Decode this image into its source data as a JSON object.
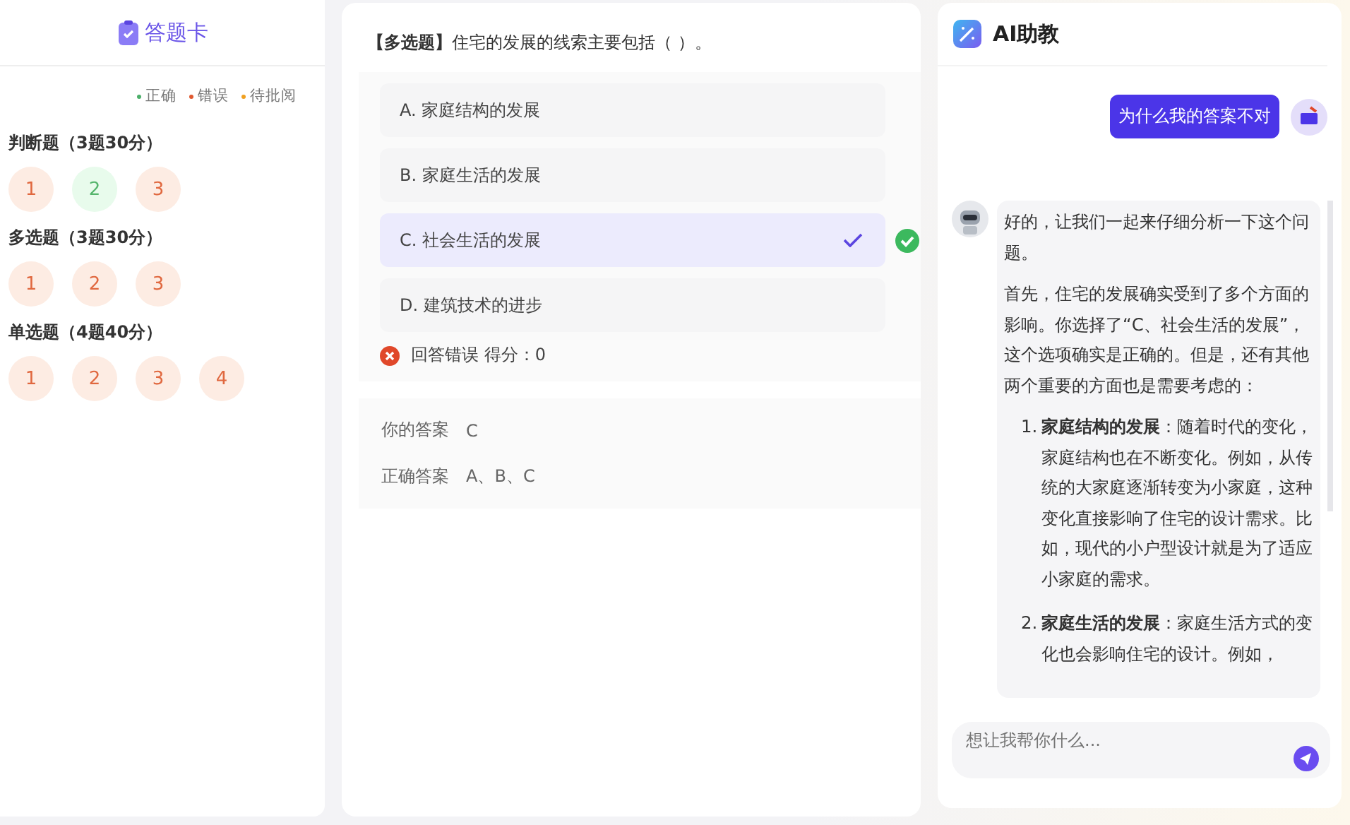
{
  "answer_card": {
    "title": "答题卡",
    "legend": [
      {
        "label": "正确",
        "color": "#4caf6a"
      },
      {
        "label": "错误",
        "color": "#e0582f"
      },
      {
        "label": "待批阅",
        "color": "#f0a020"
      }
    ],
    "sections": [
      {
        "title": "判断题（3题30分）",
        "items": [
          {
            "number": "1",
            "correct": false
          },
          {
            "number": "2",
            "correct": true
          },
          {
            "number": "3",
            "correct": false
          }
        ]
      },
      {
        "title": "多选题（3题30分）",
        "items": [
          {
            "number": "1",
            "correct": false
          },
          {
            "number": "2",
            "correct": false
          },
          {
            "number": "3",
            "correct": false
          }
        ]
      },
      {
        "title": "单选题（4题40分）",
        "items": [
          {
            "number": "1",
            "correct": false
          },
          {
            "number": "2",
            "correct": false
          },
          {
            "number": "3",
            "correct": false
          },
          {
            "number": "4",
            "correct": false
          }
        ]
      }
    ]
  },
  "question": {
    "type_label": "【多选题】",
    "text": "住宅的发展的线索主要包括（ ）。",
    "options": [
      {
        "label": "A. 家庭结构的发展",
        "selected": false,
        "marked_correct": false
      },
      {
        "label": "B. 家庭生活的发展",
        "selected": false,
        "marked_correct": false
      },
      {
        "label": "C. 社会生活的发展",
        "selected": true,
        "marked_correct": true
      },
      {
        "label": "D. 建筑技术的进步",
        "selected": false,
        "marked_correct": false
      }
    ],
    "result": {
      "kind": "wrong",
      "text": "回答错误 得分：0"
    },
    "your_answer": {
      "label": "你的答案",
      "value": "C"
    },
    "correct_answer": {
      "label": "正确答案",
      "value": "A、B、C"
    }
  },
  "assistant": {
    "title": "AI助教",
    "messages": [
      {
        "kind": "user",
        "paragraphs": [
          "为什么我的答案不对"
        ]
      },
      {
        "kind": "bot",
        "paragraphs": [
          "好的，让我们一起来仔细分析一下这个问题。",
          "首先，住宅的发展确实受到了多个方面的影响。你选择了“C、社会生活的发展”，这个选项确实是正确的。但是，还有其他两个重要的方面也是需要考虑的："
        ],
        "list": [
          {
            "number": "1.",
            "text": "**家庭结构的发展**：随着时代的变化，家庭结构也在不断变化。例如，从传统的大家庭逐渐转变为小家庭，这种变化直接影响了住宅的设计需求。比如，现代的小户型设计就是为了适应小家庭的需求。"
          },
          {
            "number": "2.",
            "text": "**家庭生活的发展**：家庭生活方式的变化也会影响住宅的设计。例如，"
          }
        ]
      }
    ],
    "input": {
      "placeholder": "想让我帮你什么..."
    }
  }
}
